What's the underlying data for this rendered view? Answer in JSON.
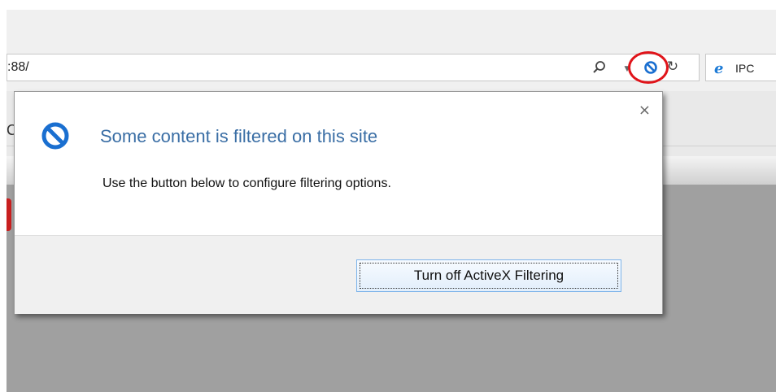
{
  "browser": {
    "address": {
      "url_fragment": ":88/"
    },
    "toolbar_icons": [
      "search-icon",
      "dropdown-arrow-icon",
      "blocked-content-icon",
      "refresh-icon"
    ],
    "tab": {
      "title": "IPC"
    },
    "page_fragment": "C"
  },
  "popup": {
    "title": "Some content is filtered on this site",
    "message": "Use the button below to configure filtering options.",
    "button_label": "Turn off ActiveX Filtering",
    "close_label": "×",
    "icon": "blocked-content-icon"
  },
  "colors": {
    "accent_title": "#3a6ea5",
    "blocked_icon": "#1a6fd0",
    "highlight_ring": "#e0141a",
    "button_border": "#7eb4ea"
  }
}
